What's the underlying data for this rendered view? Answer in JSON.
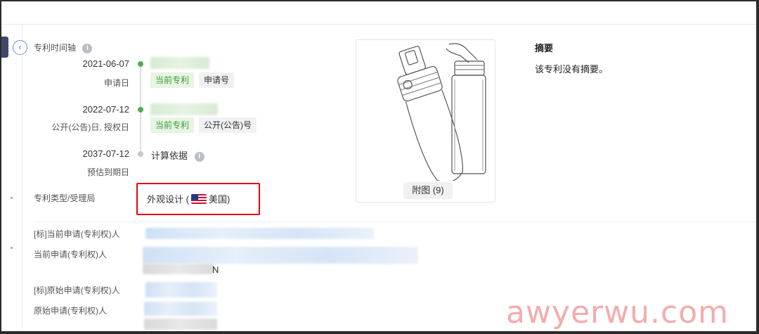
{
  "timeline": {
    "label": "专利时间轴",
    "entries": [
      {
        "date": "2021-06-07",
        "sub": "申请日",
        "tags": [
          "当前专利",
          "申请号"
        ]
      },
      {
        "date": "2022-07-12",
        "sub": "公开(公告)日, 授权日",
        "tags": [
          "当前专利",
          "公开(公告)号"
        ]
      },
      {
        "date": "2037-07-12",
        "sub": "预估到期日",
        "note": "计算依据"
      }
    ]
  },
  "patent_type": {
    "label": "专利类型/受理局",
    "type": "外观设计",
    "country": "美国",
    "open_paren": "(",
    "close_paren": ")"
  },
  "parties": {
    "current_std_label": "[标]当前申请(专利权)人",
    "current_label": "当前申请(专利权)人",
    "current_tail": "N",
    "original_std_label": "[标]原始申请(专利权)人",
    "original_label": "原始申请(专利权)人"
  },
  "figure": {
    "button_label": "附图 (9)"
  },
  "abstract": {
    "title": "摘要",
    "text": "该专利没有摘要。"
  },
  "watermark": "awyerwu.com",
  "icons": {
    "collapse": "‹",
    "info": "i"
  },
  "colors": {
    "green": "#4caf50",
    "highlight": "#e60012",
    "accent": "#4a6fc9"
  }
}
